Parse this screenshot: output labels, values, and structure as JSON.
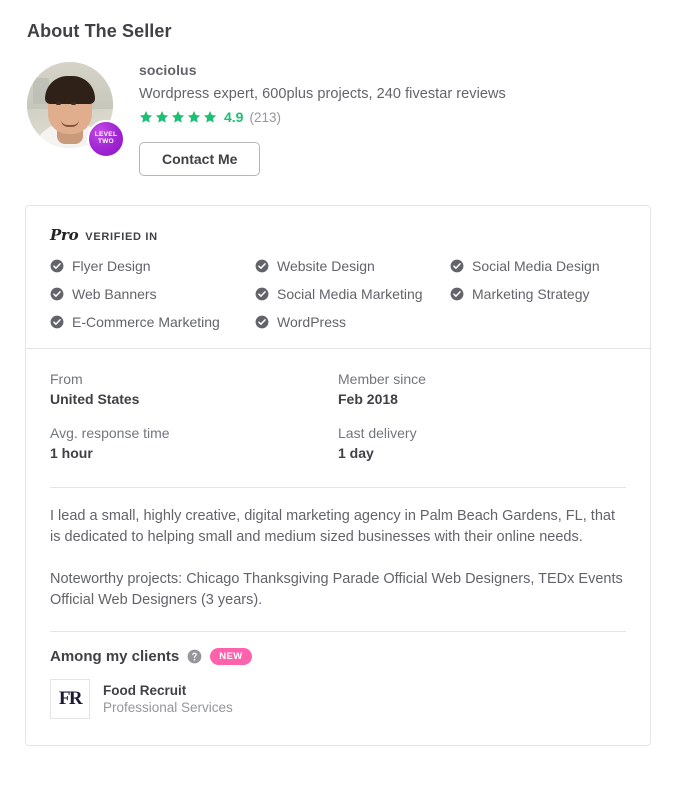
{
  "page": {
    "title": "About The Seller"
  },
  "seller": {
    "name": "sociolus",
    "tagline": "Wordpress expert, 600plus projects, 240 fivestar reviews",
    "level_badge_line1": "LEVEL",
    "level_badge_line2": "TWO",
    "rating_score": "4.9",
    "rating_count": "(213)",
    "stars_filled": 5,
    "contact_label": "Contact Me",
    "star_color": "#1dbf73",
    "level_badge_color": "#a32ad4"
  },
  "pro": {
    "logo_text": "Pro",
    "verified_label": "VERIFIED IN",
    "skills": [
      "Flyer Design",
      "Website Design",
      "Social Media Design",
      "Web Banners",
      "Social Media Marketing",
      "Marketing Strategy",
      "E-Commerce Marketing",
      "WordPress"
    ]
  },
  "stats": [
    {
      "label": "From",
      "value": "United States"
    },
    {
      "label": "Member since",
      "value": "Feb 2018"
    },
    {
      "label": "Avg. response time",
      "value": "1 hour"
    },
    {
      "label": "Last delivery",
      "value": "1 day"
    }
  ],
  "description": {
    "paragraph1": "I lead a small, highly creative, digital marketing agency in Palm Beach Gardens, FL, that is dedicated to helping small and medium sized businesses with their online needs.",
    "paragraph2": "Noteworthy projects: Chicago Thanksgiving Parade Official Web Designers, TEDx Events Official Web Designers (3 years)."
  },
  "clients": {
    "title": "Among my clients",
    "badge": "NEW",
    "badge_color": "#ff62ad",
    "items": [
      {
        "monogram": "FR",
        "name": "Food Recruit",
        "category": "Professional Services"
      }
    ]
  }
}
